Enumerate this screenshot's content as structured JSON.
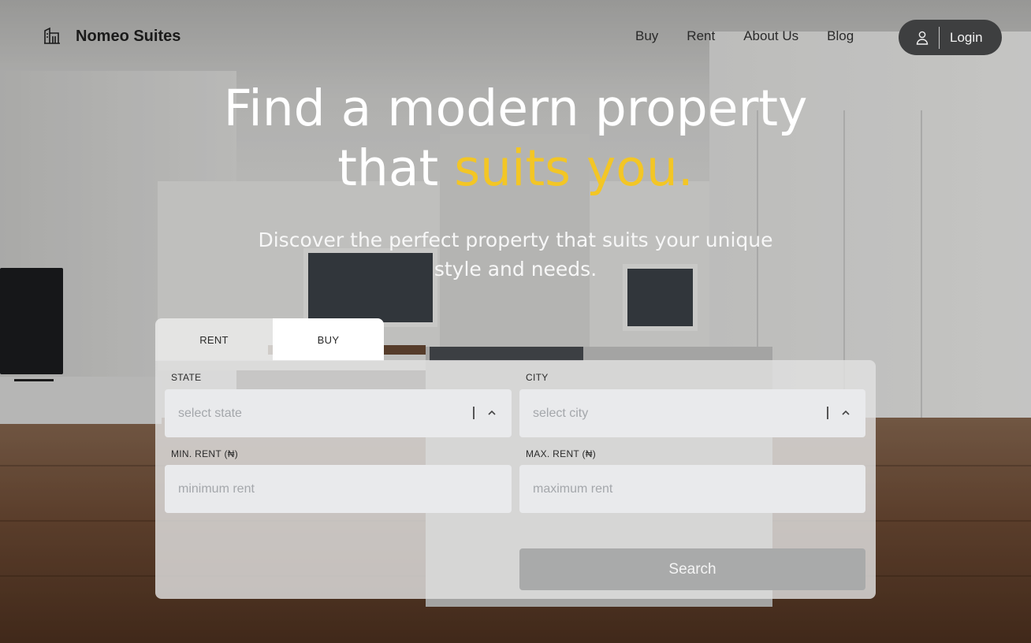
{
  "header": {
    "brand_name": "Nomeo Suites",
    "nav": [
      {
        "label": "Buy"
      },
      {
        "label": "Rent"
      },
      {
        "label": "About Us"
      },
      {
        "label": "Blog"
      }
    ],
    "login_label": "Login"
  },
  "hero": {
    "title_line1": "Find a modern property",
    "title_line2_prefix": "that ",
    "title_line2_accent": "suits you.",
    "subtitle": "Discover the perfect property that suits your unique style and needs."
  },
  "search": {
    "tabs": [
      {
        "label": "RENT",
        "active": false
      },
      {
        "label": "BUY",
        "active": true
      }
    ],
    "state": {
      "label": "STATE",
      "placeholder": "select state"
    },
    "city": {
      "label": "CITY",
      "placeholder": "select city"
    },
    "min_rent": {
      "label": "MIN. RENT (₦)",
      "placeholder": "minimum rent"
    },
    "max_rent": {
      "label": "MAX. RENT (₦)",
      "placeholder": "maximum rent"
    },
    "button_label": "Search"
  },
  "icons": {
    "brand": "building-icon",
    "login": "user-icon",
    "select_toggle": "chevron-up-icon"
  },
  "colors": {
    "accent": "#f3c625",
    "login_bg": "#3e3f40",
    "search_button": "#a9aaaa"
  }
}
